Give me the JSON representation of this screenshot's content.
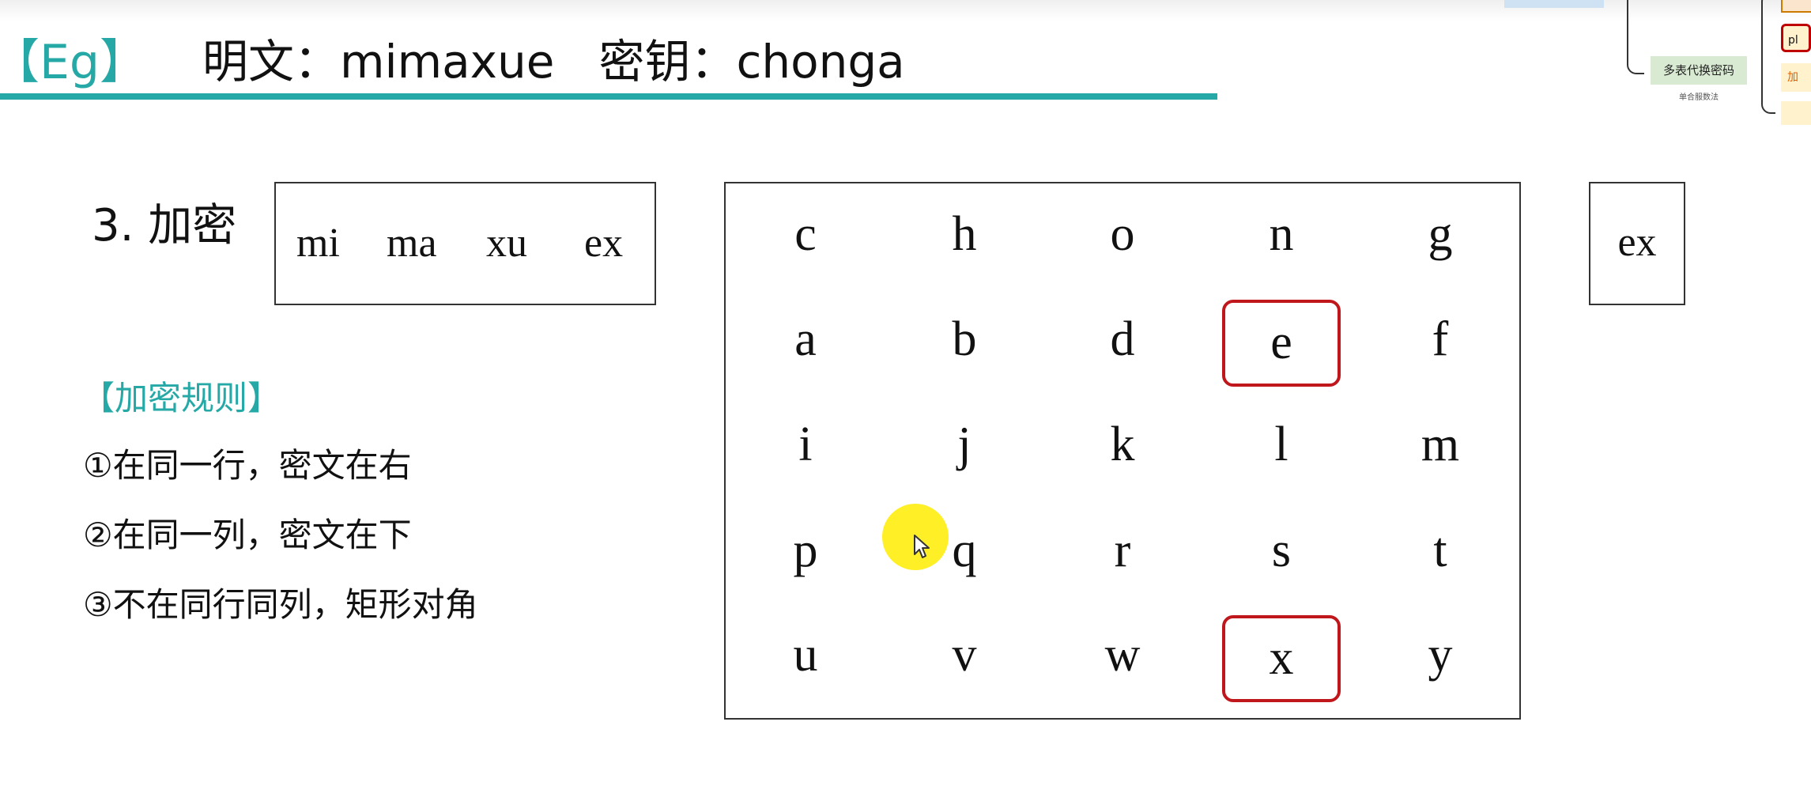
{
  "header": {
    "eg_tag": "【Eg】",
    "plaintext": "明文：mimaxue",
    "key": "密钥：chonga",
    "accent_color": "#26a9a6"
  },
  "mindmap": {
    "node_label": "多表代换密码",
    "node_sub": "单合服数法",
    "box_2_text": "pl",
    "box_3_text": "加"
  },
  "step": {
    "title": "3. 加密",
    "pairs": [
      "mi",
      "ma",
      "xu",
      "ex"
    ]
  },
  "rules": {
    "title": "【加密规则】",
    "items": [
      "①在同一行，密文在右",
      "②在同一列，密文在下",
      "③不在同行同列，矩形对角"
    ]
  },
  "matrix": {
    "rows": [
      [
        "c",
        "h",
        "o",
        "n",
        "g"
      ],
      [
        "a",
        "b",
        "d",
        "e",
        "f"
      ],
      [
        "i",
        "j",
        "k",
        "l",
        "m"
      ],
      [
        "p",
        "q",
        "r",
        "s",
        "t"
      ],
      [
        "u",
        "v",
        "w",
        "x",
        "y"
      ]
    ],
    "highlighted": [
      "e",
      "x"
    ],
    "highlight_color": "#c0171d"
  },
  "result": {
    "text": "ex"
  }
}
